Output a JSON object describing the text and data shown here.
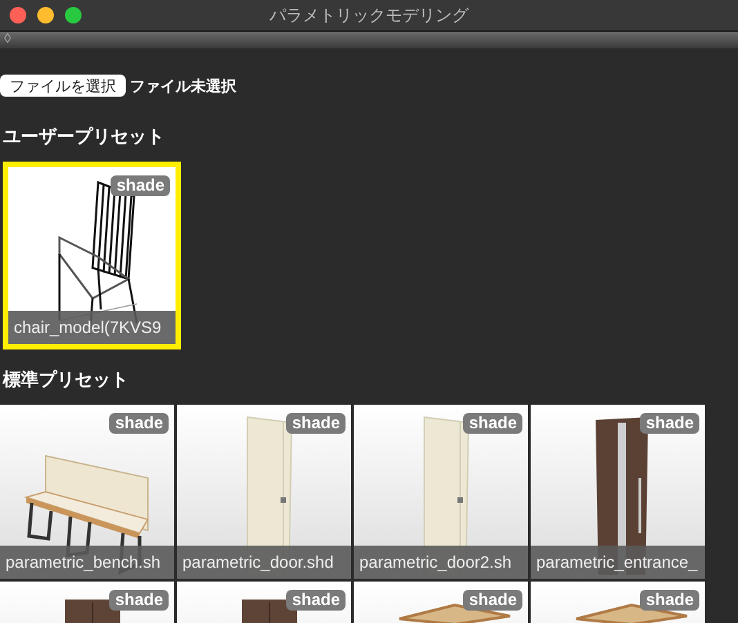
{
  "window": {
    "title": "パラメトリックモデリング"
  },
  "toolbar": {
    "icon": "◊"
  },
  "file_picker": {
    "button": "ファイルを選択",
    "status": "ファイル未選択"
  },
  "user_presets": {
    "heading": "ユーザープリセット",
    "items": [
      {
        "kind": "chair",
        "badge": "shade",
        "label": "chair_model(7KVS9",
        "selected": true
      }
    ]
  },
  "standard_presets": {
    "heading": "標準プリセット",
    "items": [
      {
        "kind": "bench",
        "badge": "shade",
        "label": "parametric_bench.sh",
        "selected": false
      },
      {
        "kind": "door",
        "badge": "shade",
        "label": "parametric_door.shd",
        "selected": false
      },
      {
        "kind": "door",
        "badge": "shade",
        "label": "parametric_door2.sh",
        "selected": false
      },
      {
        "kind": "entrance",
        "badge": "shade",
        "label": "parametric_entrance_",
        "selected": false
      },
      {
        "kind": "cabinet",
        "badge": "shade",
        "selected": false
      },
      {
        "kind": "cabinet",
        "badge": "shade",
        "selected": false
      },
      {
        "kind": "table",
        "badge": "shade",
        "selected": false
      },
      {
        "kind": "table",
        "badge": "shade",
        "selected": false
      }
    ]
  }
}
